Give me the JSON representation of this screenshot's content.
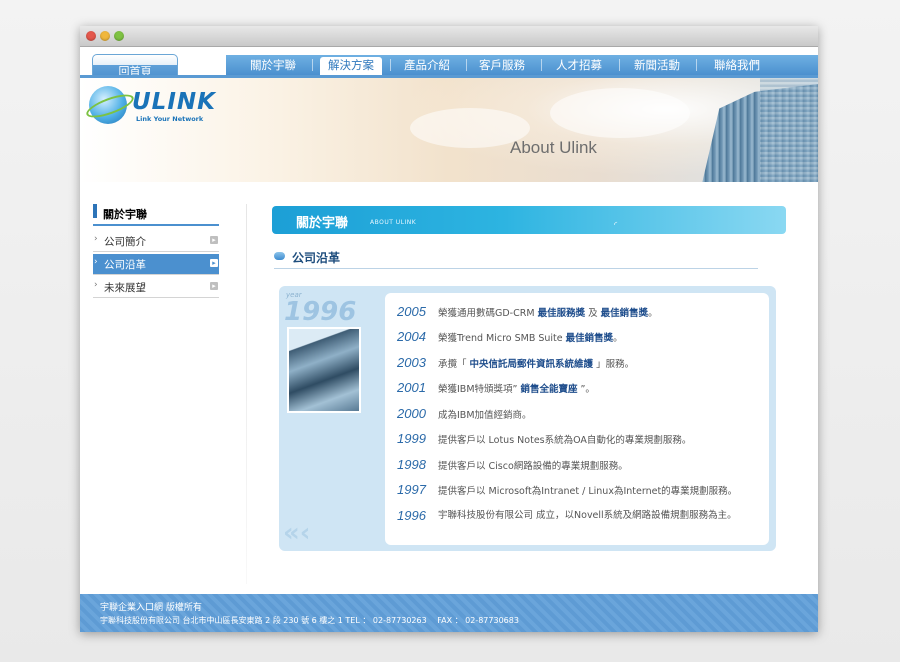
{
  "nav": {
    "home": "回首頁",
    "items": [
      "關於宇聯",
      "解決方案",
      "產品介紹",
      "客戶服務",
      "人才招募",
      "新聞活動",
      "聯絡我們"
    ]
  },
  "banner": {
    "logo_text": "ULINK",
    "logo_tagline": "Link Your Network",
    "title": "About Ulink"
  },
  "sidebar": {
    "header": "關於宇聯",
    "items": [
      {
        "label": "公司簡介"
      },
      {
        "label": "公司沿革"
      },
      {
        "label": "未來展望"
      }
    ]
  },
  "content": {
    "header": "關於宇聯",
    "header_sub": "ABOUT ULINK",
    "section_title": "公司沿革",
    "year_caption": "year",
    "big_year": "1996",
    "entries": [
      {
        "year": "2005",
        "pre": "榮獲通用數碼GD-CRM ",
        "hl1": "最佳服務獎",
        "mid": " 及 ",
        "hl2": "最佳銷售獎",
        "post": "。"
      },
      {
        "year": "2004",
        "pre": "榮獲Trend Micro SMB Suite ",
        "hl1": "最佳銷售獎",
        "post": "。"
      },
      {
        "year": "2003",
        "pre": "承攬「 ",
        "hl1": "中央信託局郵件資訊系統維護",
        "post": " 」服務。"
      },
      {
        "year": "2001",
        "pre": "榮獲IBM特頒獎項” ",
        "hl1": "銷售全能寶座",
        "post": " ”。"
      },
      {
        "year": "2000",
        "pre": "成為IBM加值經銷商。"
      },
      {
        "year": "1999",
        "pre": "提供客戶以 Lotus Notes系統為OA自動化的專業規劃服務。"
      },
      {
        "year": "1998",
        "pre": "提供客戶以 Cisco網路設備的專業規劃服務。"
      },
      {
        "year": "1997",
        "pre": "提供客戶以 Microsoft為Intranet / Linux為Internet的專業規劃服務。"
      },
      {
        "year": "1996",
        "pre": "宇聯科技股份有限公司 成立，以Novell系統及網路設備規劃服務為主。"
      }
    ]
  },
  "footer": {
    "line1": "宇聯企業入口網 版權所有",
    "line2": "宇聯科技股份有限公司 台北市中山區長安東路 2 段 230 號 6 樓之 1 TEL ： 02-87730263 　FAX ： 02-87730683"
  },
  "colors": {
    "nav_blue": "#4b90cf",
    "header_cyan": "#2db4e1",
    "year_blue": "#2b6aa9"
  }
}
